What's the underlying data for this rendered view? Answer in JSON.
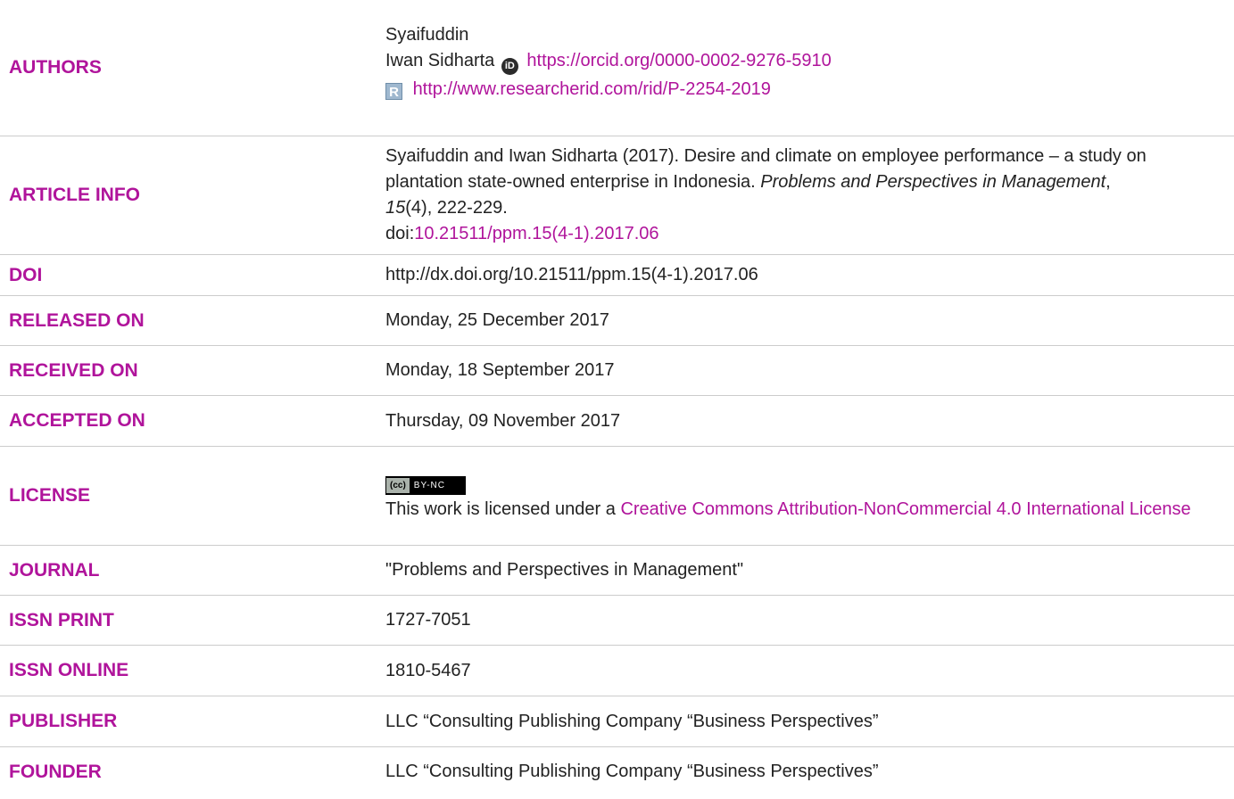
{
  "rows": {
    "authors": {
      "label": "AUTHORS",
      "author1": "Syaifuddin",
      "author2": "Iwan Sidharta",
      "orcid_link": "https://orcid.org/0000-0002-9276-5910",
      "researcherid_link": "http://www.researcherid.com/rid/P-2254-2019"
    },
    "article_info": {
      "label": "ARTICLE INFO",
      "citation_part1": "Syaifuddin and Iwan Sidharta (2017). Desire and climate on employee performance – a study on plantation state-owned enterprise in Indonesia.",
      "journal_italic": "Problems and Perspectives in Management",
      "sep1": ", ",
      "volume_italic": "15",
      "issue_pages": "(4), 222-229.",
      "doi_prefix": "doi:",
      "doi_link": "10.21511/ppm.15(4-1).2017.06"
    },
    "doi": {
      "label": "DOI",
      "value": "http://dx.doi.org/10.21511/ppm.15(4-1).2017.06"
    },
    "released": {
      "label": "RELEASED ON",
      "value": "Monday, 25 December 2017"
    },
    "received": {
      "label": "RECEIVED ON",
      "value": "Monday, 18 September 2017"
    },
    "accepted": {
      "label": "ACCEPTED ON",
      "value": "Thursday, 09 November 2017"
    },
    "license": {
      "label": "LICENSE",
      "badge_cc": "(cc)",
      "badge_terms": "BY-NC",
      "text_prefix": "This work is licensed under a ",
      "link": "Creative Commons Attribution-NonCommercial 4.0 International License"
    },
    "journal": {
      "label": "JOURNAL",
      "value": "\"Problems and Perspectives in Management\""
    },
    "issn_print": {
      "label": "ISSN PRINT",
      "value": "1727-7051"
    },
    "issn_online": {
      "label": "ISSN ONLINE",
      "value": "1810-5467"
    },
    "publisher": {
      "label": "PUBLISHER",
      "value": "LLC “Consulting Publishing Company “Business Perspectives”"
    },
    "founder": {
      "label": "FOUNDER",
      "value": "LLC “Consulting Publishing Company “Business Perspectives”"
    }
  },
  "colors": {
    "accent": "#b0149b",
    "text": "#222222",
    "divider": "#cccccc"
  },
  "icons": [
    "orcid-icon",
    "researcherid-icon",
    "cc-by-nc-badge"
  ]
}
